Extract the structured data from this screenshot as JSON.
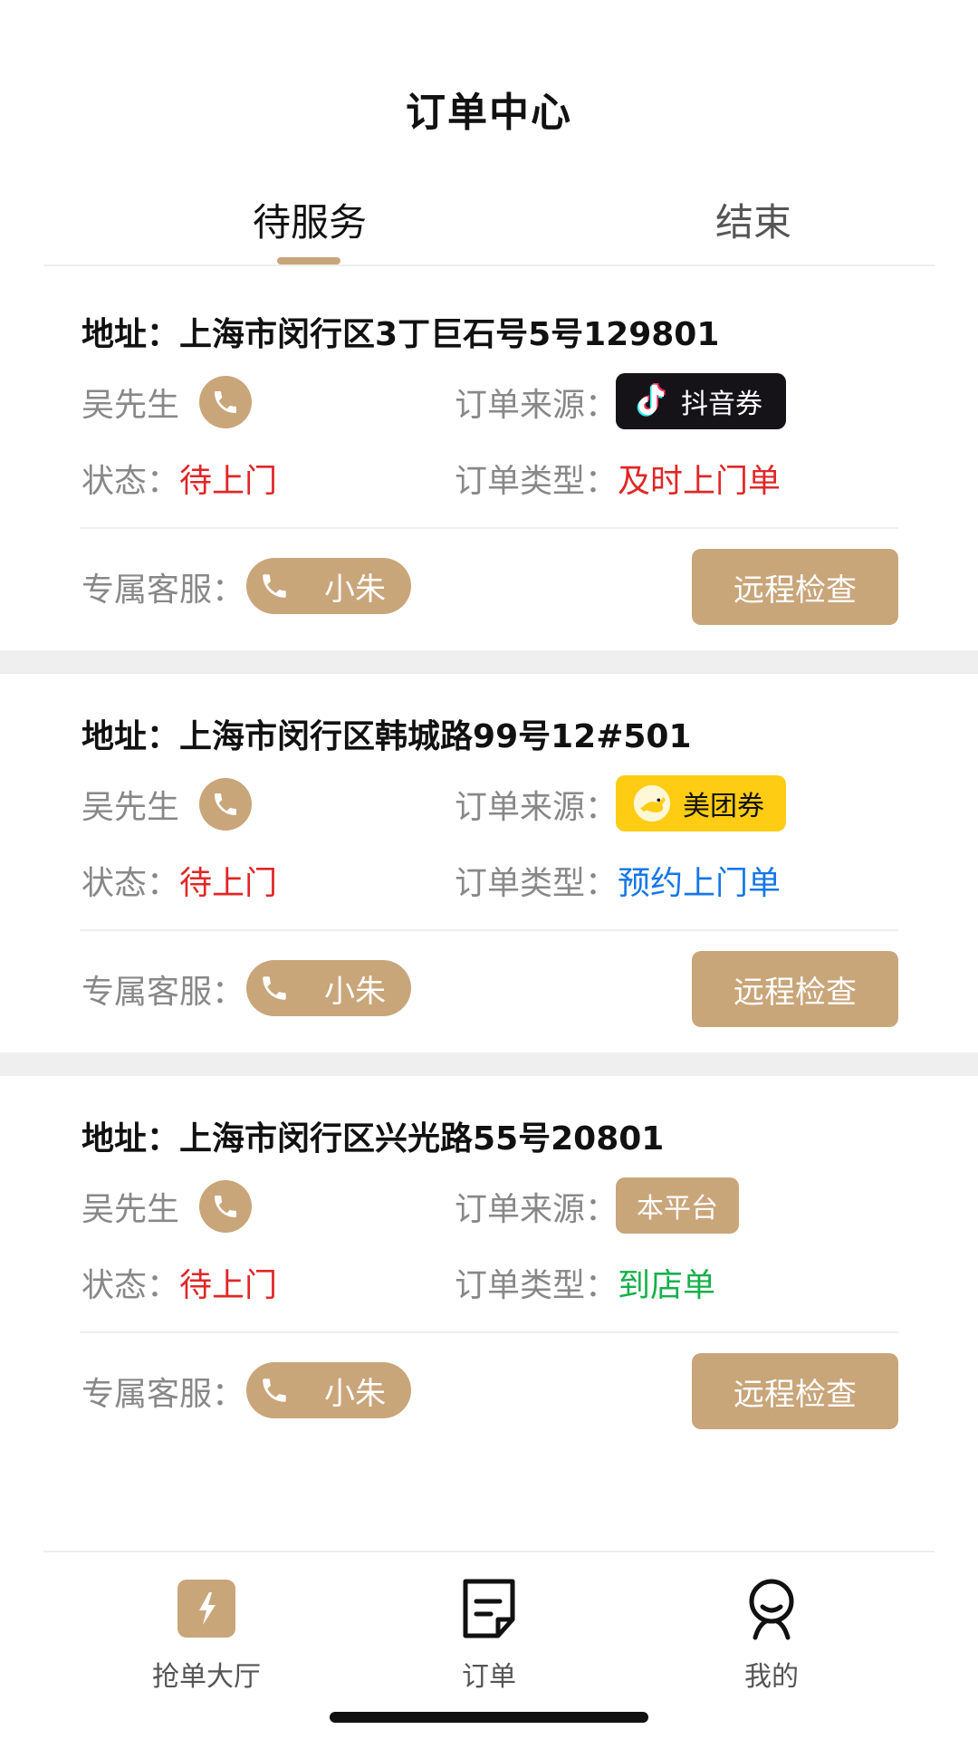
{
  "header": {
    "title": "订单中心"
  },
  "tabs": [
    {
      "label": "待服务",
      "active": true
    },
    {
      "label": "结束",
      "active": false
    }
  ],
  "labels": {
    "address_prefix": "地址：",
    "source_label": "订单来源：",
    "status_label": "状态：",
    "type_label": "订单类型：",
    "cs_label": "专属客服：",
    "remote_button": "远程检查"
  },
  "orders": [
    {
      "address": "上海市闵行区3丁巨石号5号129801",
      "customer": "吴先生",
      "source": "抖音券",
      "source_icon": "douyin-logo-icon",
      "status": "待上门",
      "type": "及时上门单",
      "type_color": "#e02727",
      "cs_name": "小朱"
    },
    {
      "address": "上海市闵行区韩城路99号12#501",
      "customer": "吴先生",
      "source": "美团券",
      "source_icon": "meituan-kangaroo-icon",
      "status": "待上门",
      "type": "预约上门单",
      "type_color": "#1677e5",
      "cs_name": "小朱"
    },
    {
      "address": "上海市闵行区兴光路55号20801",
      "customer": "吴先生",
      "source": "本平台",
      "source_icon": "",
      "status": "待上门",
      "type": "到店单",
      "type_color": "#17b04a",
      "cs_name": "小朱"
    }
  ],
  "bottom_nav": [
    {
      "label": "抢单大厅",
      "icon": "lightning-icon",
      "active": false
    },
    {
      "label": "订单",
      "icon": "order-document-icon",
      "active": true
    },
    {
      "label": "我的",
      "icon": "profile-icon",
      "active": false
    }
  ],
  "colors": {
    "accent": "#c9a57a",
    "status_red": "#e02727",
    "type_blue": "#1677e5",
    "type_green": "#17b04a",
    "douyin_bg": "#161318",
    "meituan_bg": "#ffcc14"
  }
}
